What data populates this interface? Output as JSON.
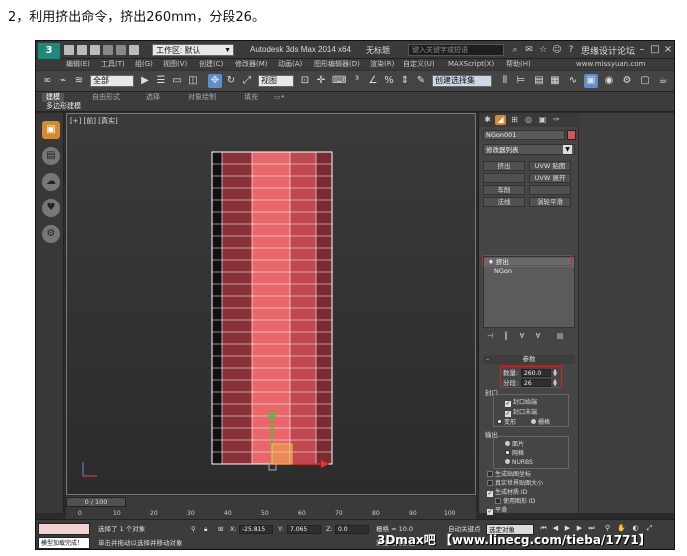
{
  "caption": "2，利用挤出命令，挤出260mm，分段26。",
  "titlebar": {
    "workspace_label": "工作区: 默认",
    "app_title": "Autodesk 3ds Max  2014 x64",
    "doc_title": "无标题",
    "search_placeholder": "键入关键字或短语",
    "forum_text": "思缘设计论坛",
    "logo_text": "3"
  },
  "menu": {
    "items": [
      "编辑(E)",
      "工具(T)",
      "组(G)",
      "视图(V)",
      "创建(C)",
      "修改器(M)",
      "动画(A)",
      "图形编辑器(D)",
      "渲染(R)",
      "自定义(U)",
      "MAXScript(X)",
      "帮助(H)"
    ],
    "watermark": "www.missyuan.com"
  },
  "toolbar": {
    "selection_filter": "全部",
    "view_label": "视图",
    "named_selection": "创建选择集"
  },
  "ribbon": {
    "tabs": [
      "建模",
      "自由形式",
      "选择",
      "对象绘制",
      "填充"
    ],
    "subtitle": "多边形建模"
  },
  "viewport": {
    "label": "[+] [前] [真实]"
  },
  "command_panel": {
    "object_name": "NGon001",
    "modifier_list": "修改器列表",
    "buttons": [
      "挤出",
      "UVW 贴图",
      "",
      "UVW 展开",
      "车削",
      "",
      "法线",
      "涡轮平滑"
    ],
    "stack": [
      "挤出",
      "NGon"
    ],
    "rollout_title": "参数",
    "amount_label": "数量:",
    "amount_value": "260.0",
    "segments_label": "分段:",
    "segments_value": "26",
    "capping_label": "封口",
    "cap_start": "封口始端",
    "cap_end": "封口末端",
    "morph": "变形",
    "grid": "栅格",
    "output_label": "输出",
    "out_patch": "面片",
    "out_mesh": "网格",
    "out_nurbs": "NURBS",
    "gen_mapping": "生成贴图坐标",
    "real_world": "真实世界贴图大小",
    "gen_mat_ids": "生成材质 ID",
    "use_shape_ids": "使用图形 ID",
    "smooth": "平滑"
  },
  "timeline": {
    "frame_label": "0 / 100",
    "ticks": [
      "0",
      "10",
      "20",
      "30",
      "40",
      "50",
      "60",
      "70",
      "80",
      "90",
      "100"
    ]
  },
  "status": {
    "selected": "选择了 1 个对象",
    "hint": "单击并拖动以选择并移动对象",
    "script_msg": "模型加载完成！",
    "x_value": "-25.815",
    "y_value": "7.065",
    "z_value": "0.0",
    "grid_label": "栅格 = 10.0",
    "add_time_tag": "添加时间标记",
    "autokey": "自动关键点",
    "select_object": "选定对象"
  },
  "brand": "3Dmax吧 【www.linecg.com/tieba/1771】",
  "colors": {
    "accent": "#d48a30",
    "object_color": "#d9535a",
    "highlight_red": "#e02020",
    "mesh_light": "#e8676b",
    "mesh_dark": "#8a3238"
  }
}
